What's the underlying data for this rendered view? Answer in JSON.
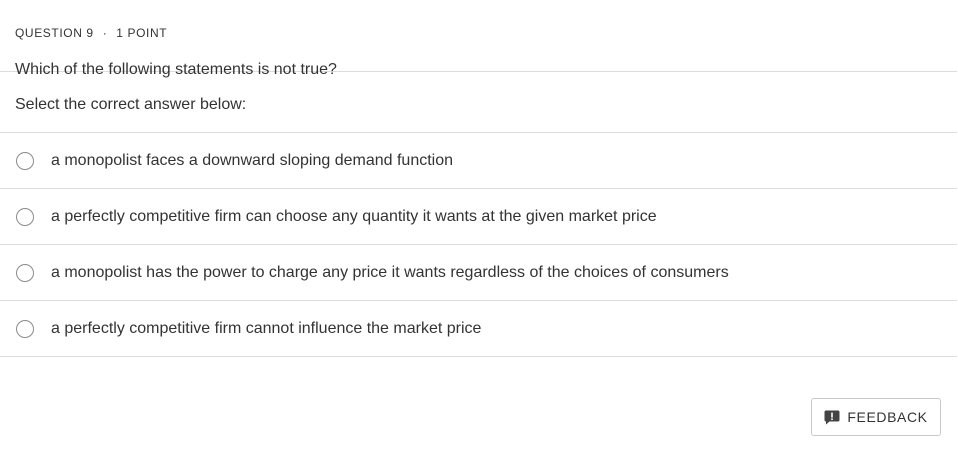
{
  "question": {
    "number_label": "QUESTION 9",
    "separator": "·",
    "points_label": "1 POINT",
    "text": "Which of the following statements is not true?"
  },
  "prompt": "Select the correct answer below:",
  "options": [
    {
      "label": "a monopolist faces a downward sloping demand function",
      "selected": false
    },
    {
      "label": "a perfectly competitive firm can choose any quantity it wants at the given market price",
      "selected": false
    },
    {
      "label": "a monopolist has the power to charge any price it wants regardless of the choices of consumers",
      "selected": false
    },
    {
      "label": "a perfectly competitive firm cannot influence the market price",
      "selected": false
    }
  ],
  "feedback_button": {
    "label": "FEEDBACK",
    "icon": "feedback-chat-icon"
  },
  "colors": {
    "text": "#333333",
    "divider": "#dcdcdc",
    "radio_border": "#8a8a8a"
  }
}
